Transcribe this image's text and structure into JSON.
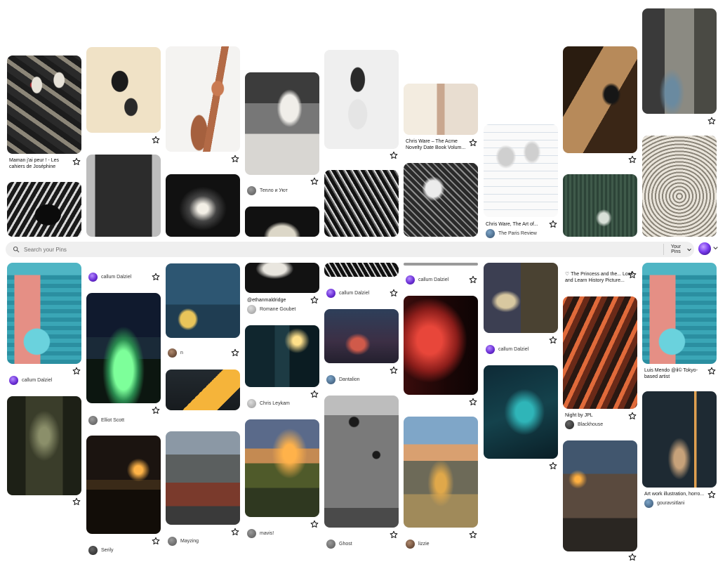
{
  "search": {
    "placeholder": "Search your Pins",
    "scope_label": "Your Pins",
    "scope_icon": "chevron-down-icon",
    "search_icon": "search-icon"
  },
  "icons": {
    "save": "star-outline-icon"
  },
  "colors": {
    "page_bg": "#ffffff",
    "search_bg": "#efefef",
    "avatar_accent": "#7a3cf0"
  },
  "pins": {
    "c1a": {
      "title": "Maman j'ai peur ! - Les cahiers de Joséphine"
    },
    "c1b": {
      "user": "callum Dalziel"
    },
    "c2b": {
      "user": "callum Dalziel"
    },
    "c2c": {
      "user": "Elliot Scott"
    },
    "c2d": {
      "user": "Serily"
    },
    "c3d": {
      "user": "n"
    },
    "c3f": {
      "user": "Mayzing"
    },
    "c4a": {
      "user": "Тепло и Уют"
    },
    "c4b": {
      "title": "@ethanmaldridge",
      "user": "Romane Goubet"
    },
    "c4c": {
      "user": "Chris Leykam"
    },
    "c4d": {
      "user": "mavis!"
    },
    "c5b": {
      "user": "callum Dalziel"
    },
    "c5c": {
      "user": "Dantalion"
    },
    "c5d": {
      "user": "Ghost"
    },
    "c6a": {
      "title": "Chris Ware – The Acme Novelty Date Book Volum..."
    },
    "c6b": {
      "user": "callum Dalziel"
    },
    "c6d": {
      "user": "lizzie"
    },
    "c7a": {
      "title": "Chris Ware, The Art of...",
      "user": "The Paris Review"
    },
    "c7b": {
      "user": "callum Dalziel"
    },
    "c8b": {
      "title": "♡ The Princess and the... Look and Learn History Picture..."
    },
    "c8c": {
      "title": "Night by JPL",
      "user": "Blackhouse"
    },
    "c9b": {
      "title": "Luis Mendo @ⅱ© Tokyo-based artist"
    },
    "c9c": {
      "title": "Art work illustration, horro...",
      "user": "gouravsitlani"
    }
  }
}
